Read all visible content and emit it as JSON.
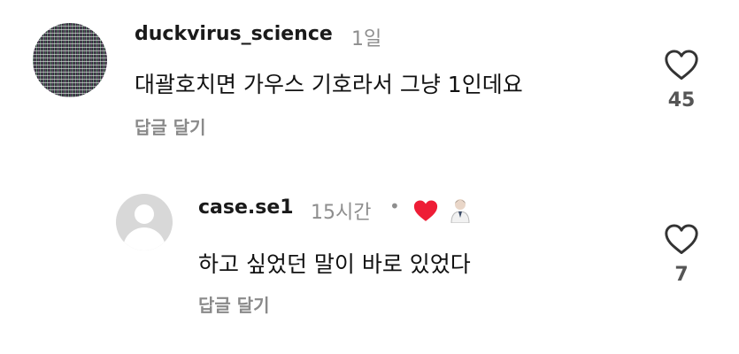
{
  "comments": [
    {
      "username": "duckvirus_science",
      "time": "1일",
      "text": "대괄호치면 가우스 기호라서 그냥 1인데요",
      "reply_label": "답글 달기",
      "like_count": "45",
      "avatar_icon": "profile-photo"
    },
    {
      "username": "case.se1",
      "time": "15시간",
      "separator": "•",
      "creator_liked": true,
      "creator_heart_color": "#ee1d36",
      "text": "하고 싶었던 말이 바로 있었다",
      "reply_label": "답글 달기",
      "like_count": "7",
      "avatar_icon": "default-user-avatar"
    }
  ],
  "colors": {
    "username": "#1a1a1a",
    "secondary_text": "#8e8e8e",
    "reply": "#8a8a8a",
    "heart_outline": "#333333",
    "heart_red": "#ee1d36"
  }
}
